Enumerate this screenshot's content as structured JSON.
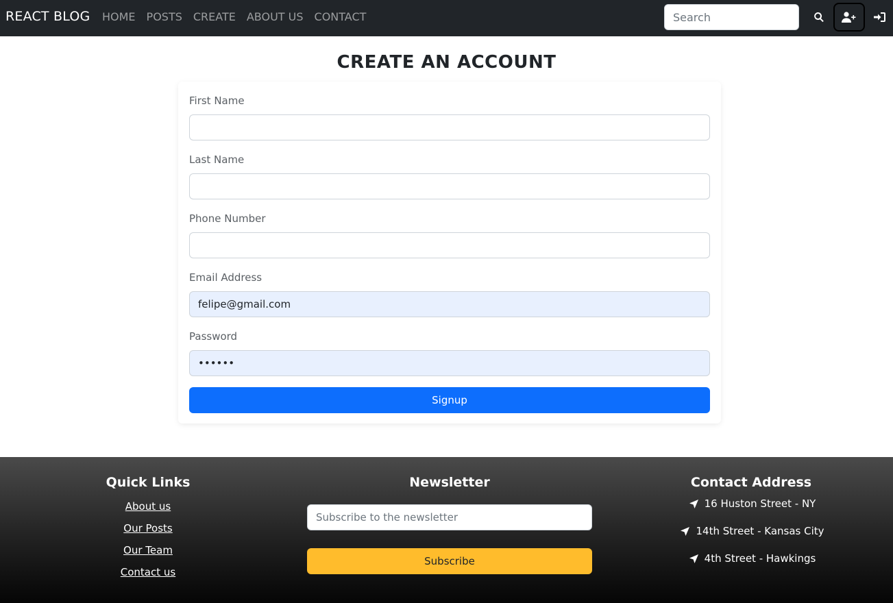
{
  "navbar": {
    "brand": "REACT BLOG",
    "links": [
      "HOME",
      "POSTS",
      "CREATE",
      "ABOUT US",
      "CONTACT"
    ],
    "search_placeholder": "Search",
    "icons": [
      "search-icon",
      "user-plus-icon",
      "sign-in-icon"
    ]
  },
  "form": {
    "title": "CREATE AN ACCOUNT",
    "first_name_label": "First Name",
    "first_name_value": "",
    "last_name_label": "Last Name",
    "last_name_value": "",
    "phone_label": "Phone Number",
    "phone_value": "",
    "email_label": "Email Address",
    "email_value": "felipe@gmail.com",
    "password_label": "Password",
    "password_value": "123456",
    "submit_label": "Signup"
  },
  "footer": {
    "quick_links_title": "Quick Links",
    "quick_links": [
      "About us",
      "Our Posts",
      "Our Team",
      "Contact us"
    ],
    "newsletter_title": "Newsletter",
    "newsletter_placeholder": "Subscribe to the newsletter",
    "subscribe_label": "Subscribe",
    "contact_title": "Contact Address",
    "addresses": [
      "16 Huston Street - NY",
      "14th Street - Kansas City",
      "4th Street - Hawkings"
    ]
  },
  "colors": {
    "navbar_bg": "#212529",
    "primary": "#0d6efd",
    "subscribe": "#ffbc2c",
    "autofill_bg": "#e8f0fe"
  }
}
